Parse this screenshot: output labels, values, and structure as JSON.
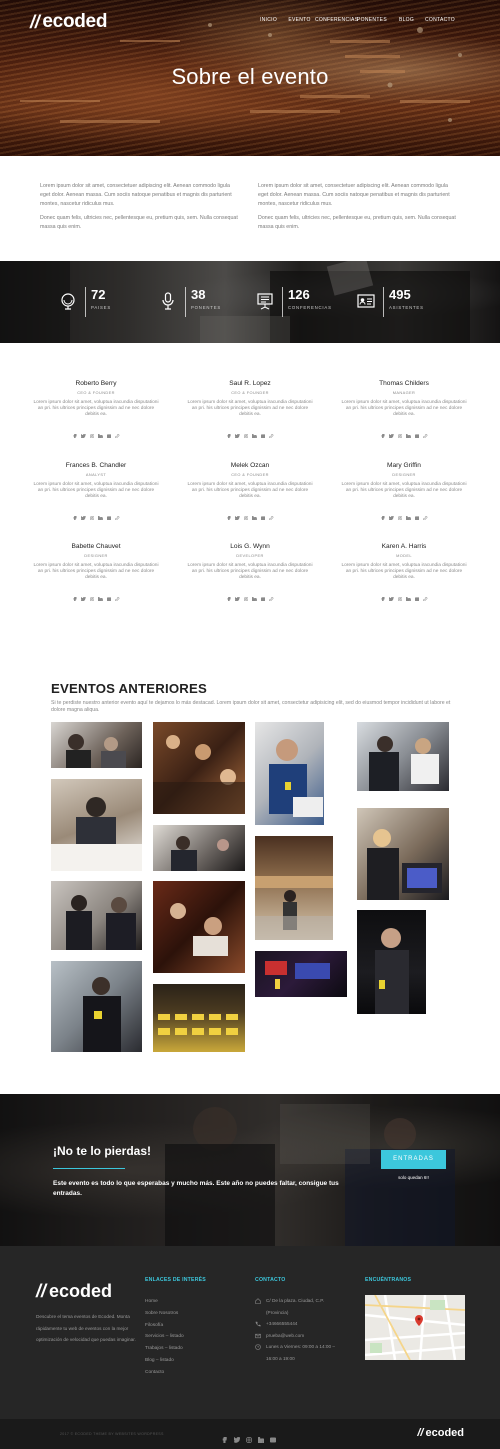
{
  "brand": {
    "logo_mark": "//",
    "logo_text": "ecoded",
    "accent_color": "#3cc7dc"
  },
  "nav": {
    "items": [
      "INICIO",
      "EVENTO",
      "CONFERENCIAS",
      "PONENTES",
      "BLOG",
      "CONTACTO"
    ]
  },
  "hero": {
    "title": "Sobre el evento"
  },
  "about": {
    "col1": [
      "Lorem ipsum dolor sit amet, consectetuer adipiscing elit. Aenean commodo ligula eget dolor. Aenean massa. Cum sociis natoque penatibus et magnis dis parturient montes, nascetur ridiculus mus.",
      "Donec quam felis, ultricies nec, pellentesque eu, pretium quis, sem. Nulla consequat massa quis enim."
    ],
    "col2": [
      "Lorem ipsum dolor sit amet, consectetuer adipiscing elit. Aenean commodo ligula eget dolor. Aenean massa. Cum sociis natoque penatibus et magnis dis parturient montes, nascetur ridiculus mus.",
      "Donec quam felis, ultricies nec, pellentesque eu, pretium quis, sem. Nulla consequat massa quis enim."
    ]
  },
  "stats": [
    {
      "value": "72",
      "label": "PAISES",
      "icon": "globe-icon"
    },
    {
      "value": "38",
      "label": "PONENTES",
      "icon": "microphone-icon"
    },
    {
      "value": "126",
      "label": "CONFERENCIAS",
      "icon": "presentation-icon"
    },
    {
      "value": "495",
      "label": "ASISTENTES",
      "icon": "id-card-icon"
    }
  ],
  "team": {
    "bio": "Lorem ipsum dolor sit amet, voluptua iracundia disputationi an pri. his ultrices principes dignissim ad ne nec dolore debitis ea.",
    "members": [
      {
        "name": "Roberto Berry",
        "role": "CEO & FOUNDER"
      },
      {
        "name": "Saul R. Lopez",
        "role": "CEO & FOUNDER"
      },
      {
        "name": "Thomas Childers",
        "role": "MANAGER"
      },
      {
        "name": "Frances B. Chandler",
        "role": "ANALYST"
      },
      {
        "name": "Melek Ozcan",
        "role": "CEO & FOUNDER"
      },
      {
        "name": "Mary Griffin",
        "role": "DESIGNER"
      },
      {
        "name": "Babette Chauvet",
        "role": "DESIGNER"
      },
      {
        "name": "Lois G. Wynn",
        "role": "DEVELOPER"
      },
      {
        "name": "Karen A. Harris",
        "role": "MODEL"
      }
    ],
    "social_icons": [
      "facebook-icon",
      "twitter-icon",
      "instagram-icon",
      "linkedin-icon",
      "youtube-icon",
      "link-icon"
    ]
  },
  "events": {
    "title": "EVENTOS ANTERIORES",
    "description": "Si te perdiste nuestro anterior evento aquí te dejamos lo más destacad. Lorem ipsum dolor sit amet, consectetur adipisicing elit, sed do eiusmod tempor incididunt ut labore et dolore magna aliqua."
  },
  "cta": {
    "title": "¡No te lo pierdas!",
    "text": "Este evento es todo lo que esperabas y mucho más. Este año no puedes faltar, consigue tus entradas.",
    "button": "ENTRADAS",
    "note": "solo quedan 6!!"
  },
  "footer": {
    "about": "Descubre el tema eventos de Ecoded. Monta rápidamente tu web de eventos con la mejor optimización de velocidad que puedas imaginar.",
    "links_title": "ENLACES DE INTERÉS",
    "links": [
      "Home",
      "Sobre Nosotros",
      "Filosofía",
      "Servicios – listado",
      "Trabajos – listado",
      "Blog – listado",
      "Contacto"
    ],
    "contact_title": "CONTACTO",
    "contact": {
      "address1": "C/ De la plaza. Ciudad, C.P.",
      "address2": "(Provincia)",
      "phone": "+34666555444",
      "email": "prueba@web.com",
      "hours1": "Lunes a Viernes: 09:00 a 14:00 –",
      "hours2": "16:00 a 19:00"
    },
    "find_title": "ENCUÉNTRANOS",
    "copyright": "2017 © ECODED THEME BY WEBSITES WORDPRESS"
  }
}
